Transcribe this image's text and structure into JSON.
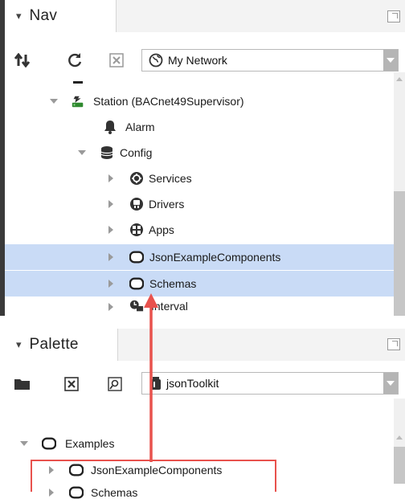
{
  "nav": {
    "title": "Nav",
    "network_combo": "My Network",
    "tree": {
      "station": "Station (BACnet49Supervisor)",
      "alarm": "Alarm",
      "config": "Config",
      "services": "Services",
      "drivers": "Drivers",
      "apps": "Apps",
      "json_example": "JsonExampleComponents",
      "schemas": "Schemas",
      "interval": "Interval"
    }
  },
  "palette": {
    "title": "Palette",
    "module_combo": "jsonToolkit",
    "tree": {
      "examples": "Examples",
      "json_example": "JsonExampleComponents",
      "schemas": "Schemas"
    }
  },
  "colors": {
    "selection": "#c9dbf6",
    "annotation": "#e8524d"
  },
  "icons": {
    "nav_toolbar": [
      "sync-toggle-icon",
      "refresh-icon",
      "close-icon",
      "globe-icon"
    ],
    "palette_toolbar": [
      "open-folder-icon",
      "close-icon",
      "find-icon",
      "palette-jar-icon"
    ]
  }
}
